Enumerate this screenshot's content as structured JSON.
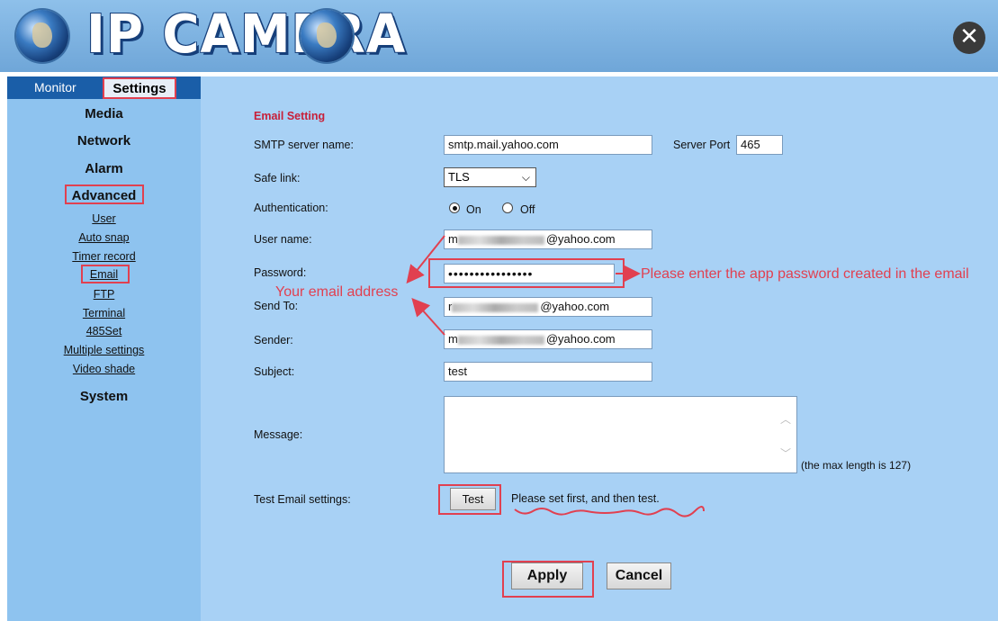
{
  "header": {
    "title": "IP CAMERA"
  },
  "sidebar": {
    "tabs": [
      {
        "label": "Monitor"
      },
      {
        "label": "Settings"
      }
    ],
    "headings": {
      "media": "Media",
      "network": "Network",
      "alarm": "Alarm",
      "advanced": "Advanced",
      "system": "System"
    },
    "advanced_items": [
      "User",
      "Auto snap",
      "Timer record",
      "Email",
      "FTP",
      "Terminal",
      "485Set",
      "Multiple settings",
      "Video shade"
    ]
  },
  "form": {
    "section_title": "Email Setting",
    "smtp_label": "SMTP server name:",
    "smtp_value": "smtp.mail.yahoo.com",
    "port_label": "Server Port",
    "port_value": "465",
    "safe_link_label": "Safe link:",
    "safe_link_value": "TLS",
    "auth_label": "Authentication:",
    "auth_on": "On",
    "auth_off": "Off",
    "auth_selected": "On",
    "user_label": "User name:",
    "user_value_suffix": "@yahoo.com",
    "user_value_prefix": "m",
    "password_label": "Password:",
    "password_value": "••••••••••••••••",
    "sendto_label": "Send To:",
    "sendto_value_prefix": "r",
    "sendto_value_suffix": "@yahoo.com",
    "sender_label": "Sender:",
    "sender_value_prefix": "m",
    "sender_value_suffix": "@yahoo.com",
    "subject_label": "Subject:",
    "subject_value": "test",
    "message_label": "Message:",
    "message_value": "",
    "max_length_note": "(the max length is 127)",
    "test_label": "Test Email settings:",
    "test_button": "Test",
    "test_hint": "Please set first, and then test.",
    "apply_button": "Apply",
    "cancel_button": "Cancel"
  },
  "annotations": {
    "password_note": "Please enter the app password created in the email",
    "email_note": "Your email address",
    "highlight_color": "#e14050"
  }
}
